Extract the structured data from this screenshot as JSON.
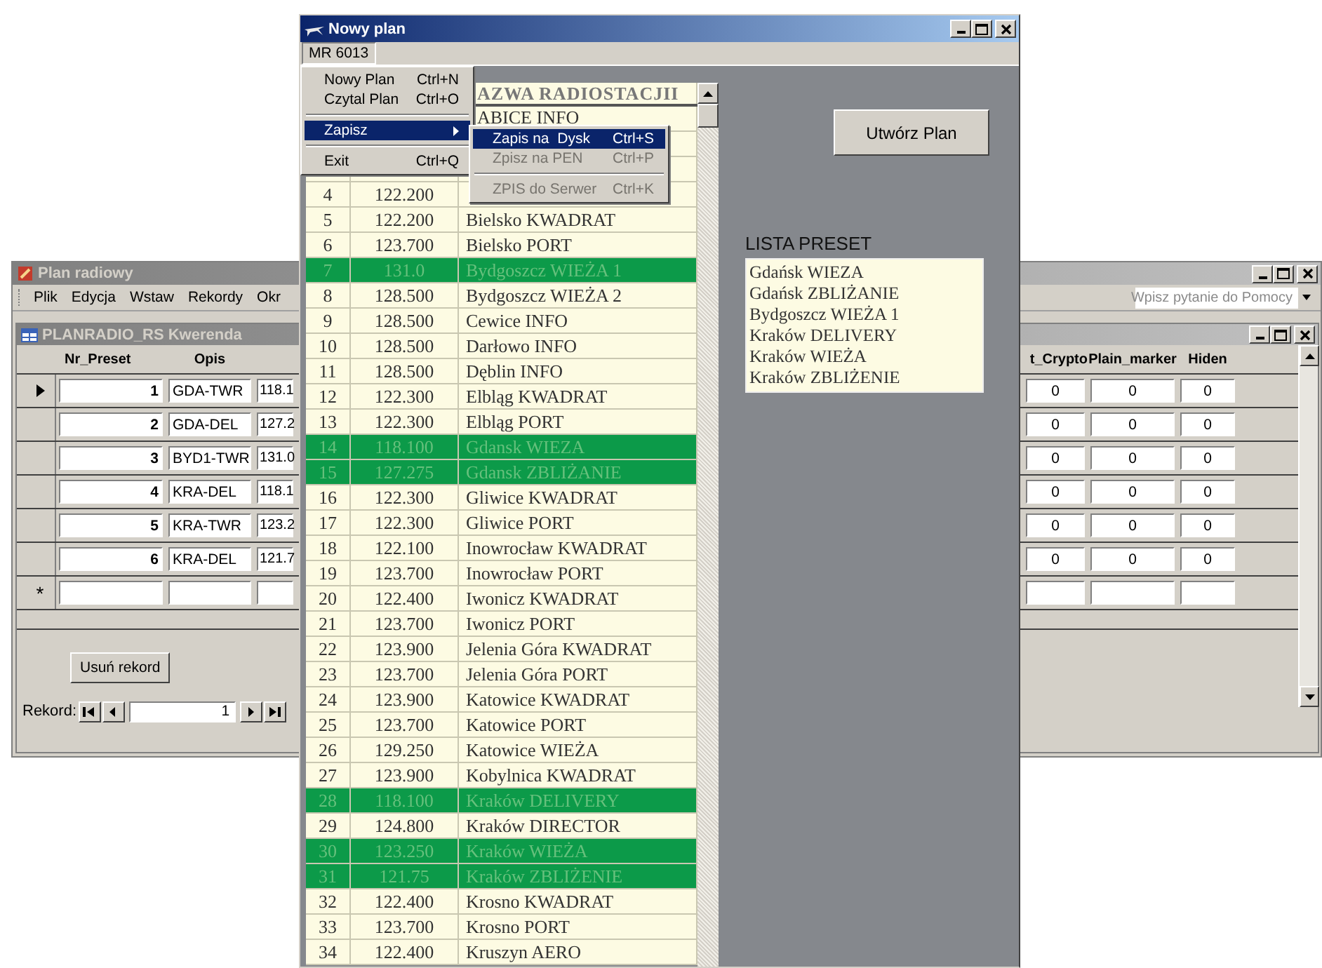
{
  "records_window": {
    "title": "Plan radiowy",
    "menu": [
      "Plik",
      "Edycja",
      "Wstaw",
      "Rekordy",
      "Okr"
    ],
    "help": {
      "placeholder": "Wpisz pytanie do Pomocy"
    },
    "query_window": {
      "title": "PLANRADIO_RS Kwerenda",
      "columns": [
        "Nr_Preset",
        "Opis",
        "t_Crypto",
        "Plain_marker",
        "Hiden"
      ],
      "rows": [
        {
          "nr": "1",
          "opis": "GDA-TWR",
          "column_3": "118.1",
          "t_crypto": "0",
          "plain_marker": "0",
          "hiden": "0",
          "current": true
        },
        {
          "nr": "2",
          "opis": "GDA-DEL",
          "column_3": "127.2",
          "t_crypto": "0",
          "plain_marker": "0",
          "hiden": "0",
          "current": false
        },
        {
          "nr": "3",
          "opis": "BYD1-TWR",
          "column_3": "131.0",
          "t_crypto": "0",
          "plain_marker": "0",
          "hiden": "0",
          "current": false
        },
        {
          "nr": "4",
          "opis": "KRA-DEL",
          "column_3": "118.1",
          "t_crypto": "0",
          "plain_marker": "0",
          "hiden": "0",
          "current": false
        },
        {
          "nr": "5",
          "opis": "KRA-TWR",
          "column_3": "123.2",
          "t_crypto": "0",
          "plain_marker": "0",
          "hiden": "0",
          "current": false
        },
        {
          "nr": "6",
          "opis": "KRA-DEL",
          "column_3": "121.7",
          "t_crypto": "0",
          "plain_marker": "0",
          "hiden": "0",
          "current": false
        }
      ],
      "new_row_marker": "*",
      "delete_button": "Usuń rekord",
      "navigator": {
        "label": "Rekord:",
        "value": "1"
      }
    }
  },
  "plan_window": {
    "title": "Nowy plan",
    "menu": [
      {
        "label": "MR 6013",
        "selected": true
      }
    ],
    "open_menu": [
      {
        "kind": "item",
        "label": "Nowy Plan",
        "shortcut": "Ctrl+N",
        "selected": false
      },
      {
        "kind": "item",
        "label": "Czytal Plan",
        "shortcut": "Ctrl+O",
        "selected": false
      },
      {
        "kind": "separator"
      },
      {
        "kind": "submenu",
        "label": "Zapisz",
        "selected": true
      },
      {
        "kind": "separator"
      },
      {
        "kind": "item",
        "label": "Exit",
        "shortcut": "Ctrl+Q",
        "selected": false
      }
    ],
    "submenu": [
      {
        "kind": "item",
        "label": "Zapis na  Dysk",
        "shortcut": "Ctrl+S",
        "selected": true,
        "disabled": false
      },
      {
        "kind": "item",
        "label": "Zpisz na PEN",
        "shortcut": "Ctrl+P",
        "selected": false,
        "disabled": true
      },
      {
        "kind": "separator"
      },
      {
        "kind": "item",
        "label": "ZPIS do Serwer",
        "shortcut": "Ctrl+K",
        "selected": false,
        "disabled": true
      }
    ],
    "table": {
      "name_header": "AZWA RADIOSTACJII",
      "rows": [
        {
          "name": "ABICE INFO",
          "highlighted": false
        },
        {
          "highlighted": false
        },
        {
          "highlighted": false
        },
        {
          "number": "4",
          "frequency": "122.200",
          "highlighted": false
        },
        {
          "number": "5",
          "frequency": "122.200",
          "name": "Bielsko KWADRAT",
          "highlighted": false
        },
        {
          "number": "6",
          "frequency": "123.700",
          "name": "Bielsko PORT",
          "highlighted": false
        },
        {
          "number": "7",
          "frequency": "131.0",
          "name": "Bydgoszcz WIEŻA 1",
          "highlighted": true
        },
        {
          "number": "8",
          "frequency": "128.500",
          "name": "Bydgoszcz WIEŻA 2",
          "highlighted": false
        },
        {
          "number": "9",
          "frequency": "128.500",
          "name": "Cewice INFO",
          "highlighted": false
        },
        {
          "number": "10",
          "frequency": "128.500",
          "name": "Darłowo INFO",
          "highlighted": false
        },
        {
          "number": "11",
          "frequency": "128.500",
          "name": "Dęblin INFO",
          "highlighted": false
        },
        {
          "number": "12",
          "frequency": "122.300",
          "name": "Elbląg KWADRAT",
          "highlighted": false
        },
        {
          "number": "13",
          "frequency": "122.300",
          "name": "Elbląg PORT",
          "highlighted": false
        },
        {
          "number": "14",
          "frequency": "118.100",
          "name": "Gdansk WIEZA",
          "highlighted": true
        },
        {
          "number": "15",
          "frequency": "127.275",
          "name": "Gdansk ZBLIŻANIE",
          "highlighted": true
        },
        {
          "number": "16",
          "frequency": "122.300",
          "name": "Gliwice KWADRAT",
          "highlighted": false
        },
        {
          "number": "17",
          "frequency": "122.300",
          "name": "Gliwice PORT",
          "highlighted": false
        },
        {
          "number": "18",
          "frequency": "122.100",
          "name": "Inowrocław KWADRAT",
          "highlighted": false
        },
        {
          "number": "19",
          "frequency": "123.700",
          "name": "Inowrocław PORT",
          "highlighted": false
        },
        {
          "number": "20",
          "frequency": "122.400",
          "name": "Iwonicz KWADRAT",
          "highlighted": false
        },
        {
          "number": "21",
          "frequency": "123.700",
          "name": "Iwonicz PORT",
          "highlighted": false
        },
        {
          "number": "22",
          "frequency": "123.900",
          "name": "Jelenia Góra KWADRAT",
          "highlighted": false
        },
        {
          "number": "23",
          "frequency": "123.700",
          "name": "Jelenia Góra PORT",
          "highlighted": false
        },
        {
          "number": "24",
          "frequency": "123.900",
          "name": "Katowice KWADRAT",
          "highlighted": false
        },
        {
          "number": "25",
          "frequency": "123.700",
          "name": "Katowice PORT",
          "highlighted": false
        },
        {
          "number": "26",
          "frequency": "129.250",
          "name": "Katowice WIEŻA",
          "highlighted": false
        },
        {
          "number": "27",
          "frequency": "123.900",
          "name": "Kobylnica KWADRAT",
          "highlighted": false
        },
        {
          "number": "28",
          "frequency": "118.100",
          "name": "Kraków DELIVERY",
          "highlighted": true
        },
        {
          "number": "29",
          "frequency": "124.800",
          "name": "Kraków DIRECTOR",
          "highlighted": false
        },
        {
          "number": "30",
          "frequency": "123.250",
          "name": "Kraków WIEŻA",
          "highlighted": true
        },
        {
          "number": "31",
          "frequency": "121.75",
          "name": "Kraków ZBLIŻENIE",
          "highlighted": true
        },
        {
          "number": "32",
          "frequency": "122.400",
          "name": "Krosno KWADRAT",
          "highlighted": false
        },
        {
          "number": "33",
          "frequency": "123.700",
          "name": "Krosno PORT",
          "highlighted": false
        },
        {
          "number": "34",
          "frequency": "122.400",
          "name": "Kruszyn AERO",
          "highlighted": false
        }
      ]
    },
    "create_button": "Utwórz Plan",
    "preset_list": {
      "label": "LISTA PRESET",
      "items": [
        "Gdańsk WIEZA",
        "Gdańsk ZBLIŻANIE",
        "Bydgoszcz WIEŻA 1",
        "Kraków DELIVERY",
        "Kraków WIEŻA",
        "Kraków ZBLIŻENIE"
      ]
    }
  }
}
